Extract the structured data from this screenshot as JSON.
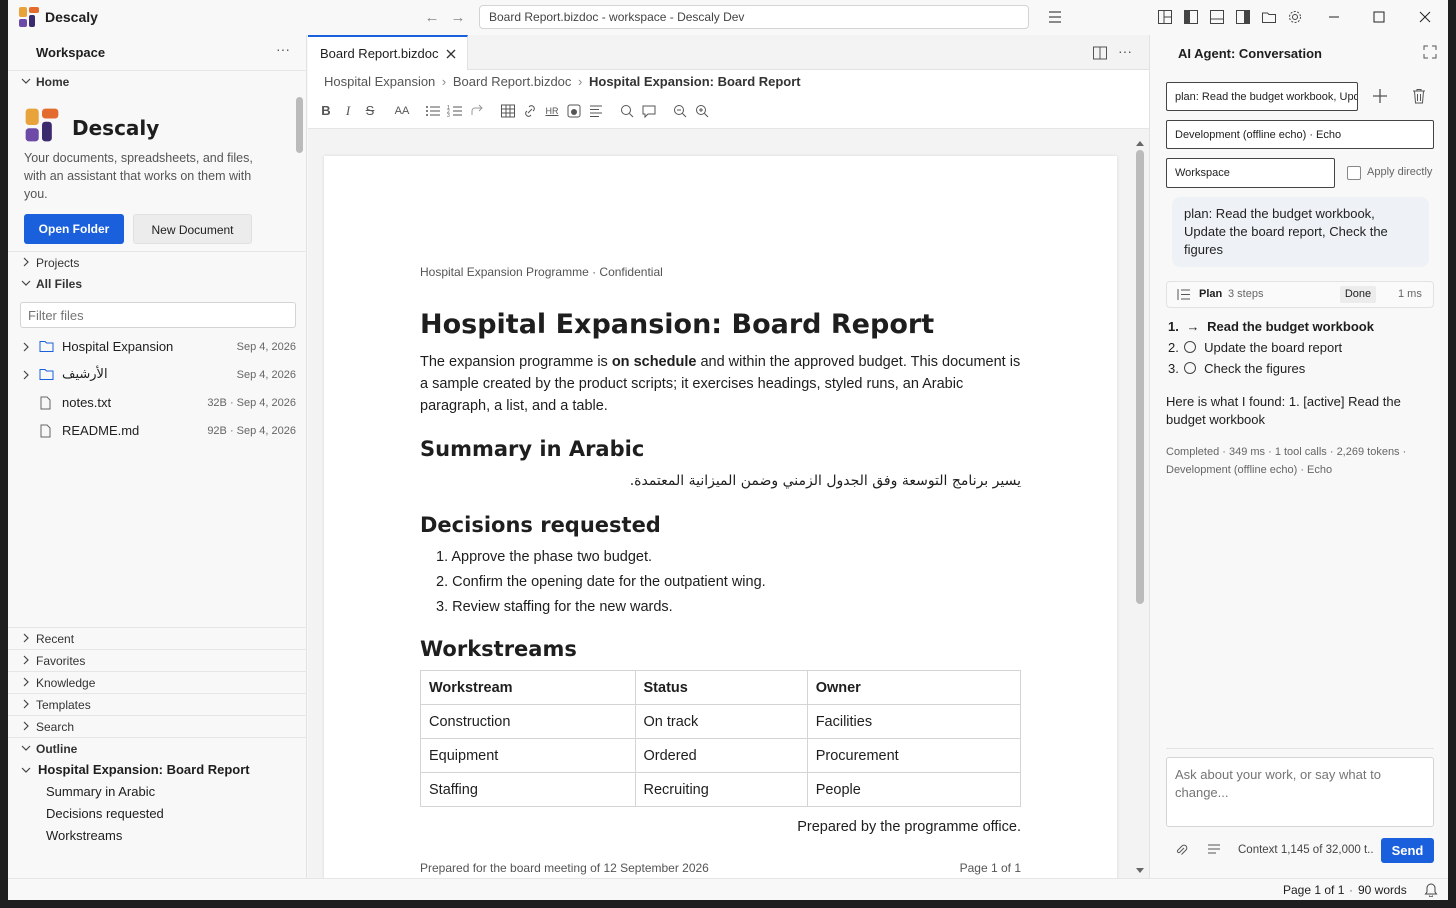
{
  "titlebar": {
    "app_name": "Descaly",
    "command_text": "Board Report.bizdoc - workspace - Descaly Dev"
  },
  "sidebar": {
    "title": "Workspace",
    "home_label": "Home",
    "brand": "Descaly",
    "tagline": "Your documents, spreadsheets, and files, with an assistant that works on them with you.",
    "open_folder": "Open Folder",
    "new_document": "New Document",
    "projects": "Projects",
    "all_files": "All Files",
    "filter_placeholder": "Filter files",
    "files": [
      {
        "name": "Hospital Expansion",
        "meta": "Sep 4, 2026",
        "type": "folder"
      },
      {
        "name": "الأرشيف",
        "meta": "Sep 4, 2026",
        "type": "folder"
      },
      {
        "name": "notes.txt",
        "meta": "32B · Sep 4, 2026",
        "type": "file"
      },
      {
        "name": "README.md",
        "meta": "92B · Sep 4, 2026",
        "type": "file"
      }
    ],
    "recent": "Recent",
    "favorites": "Favorites",
    "knowledge": "Knowledge",
    "templates": "Templates",
    "search": "Search",
    "outline": "Outline",
    "outline_items": {
      "root": "Hospital Expansion: Board Report",
      "a": "Summary in Arabic",
      "b": "Decisions requested",
      "c": "Workstreams"
    }
  },
  "editor": {
    "tab_label": "Board Report.bizdoc",
    "breadcrumb": {
      "a": "Hospital Expansion",
      "b": "Board Report.bizdoc",
      "c": "Hospital Expansion: Board Report"
    },
    "doc": {
      "header": "Hospital Expansion Programme · Confidential",
      "title": "Hospital Expansion: Board Report",
      "intro_a": "The expansion programme is ",
      "intro_bold": "on schedule",
      "intro_b": " and within the approved budget. This document is a sample created by the product scripts; it exercises headings, styled runs, an Arabic paragraph, a list, and a table.",
      "h_arabic": "Summary in Arabic",
      "arabic": "يسير برنامج التوسعة وفق الجدول الزمني وضمن الميزانية المعتمدة.",
      "h_decisions": "Decisions requested",
      "decisions": [
        "Approve the phase two budget.",
        "Confirm the opening date for the outpatient wing.",
        "Review staffing for the new wards."
      ],
      "h_workstreams": "Workstreams",
      "table": {
        "headers": [
          "Workstream",
          "Status",
          "Owner"
        ],
        "rows": [
          [
            "Construction",
            "On track",
            "Facilities"
          ],
          [
            "Equipment",
            "Ordered",
            "Procurement"
          ],
          [
            "Staffing",
            "Recruiting",
            "People"
          ]
        ]
      },
      "signoff": "Prepared by the programme office.",
      "footer_left": "Prepared for the board meeting of 12 September 2026",
      "footer_right": "Page 1 of 1"
    }
  },
  "agent": {
    "title": "AI Agent: Conversation",
    "conversation_value": "plan: Read the budget workbook, Update the board report, Check the figures",
    "model_value": "Development (offline echo) · Echo",
    "scope_value": "Workspace",
    "apply_directly": "Apply directly",
    "user_message": "plan: Read the budget workbook, Update the board report, Check the figures",
    "plan_label": "Plan",
    "plan_steps_count": "3 steps",
    "plan_status": "Done",
    "plan_time": "1 ms",
    "steps": [
      {
        "num": "1.",
        "label": "Read the budget workbook",
        "state": "active"
      },
      {
        "num": "2.",
        "label": "Update the board report",
        "state": "pending"
      },
      {
        "num": "3.",
        "label": "Check the figures",
        "state": "pending"
      }
    ],
    "reply": "Here is what I found: 1. [active] Read the budget workbook",
    "meta_line1": "Completed · 349 ms · 1 tool calls · 2,269 tokens ·",
    "meta_line2": "Development (offline echo) · Echo",
    "input_placeholder": "Ask about your work, or say what to change...",
    "context": "Context 1,145 of 32,000 t...",
    "send": "Send"
  },
  "statusbar": {
    "page": "Page 1 of 1",
    "words": "90 words"
  },
  "colors": {
    "accent": "#1a5fdb"
  }
}
